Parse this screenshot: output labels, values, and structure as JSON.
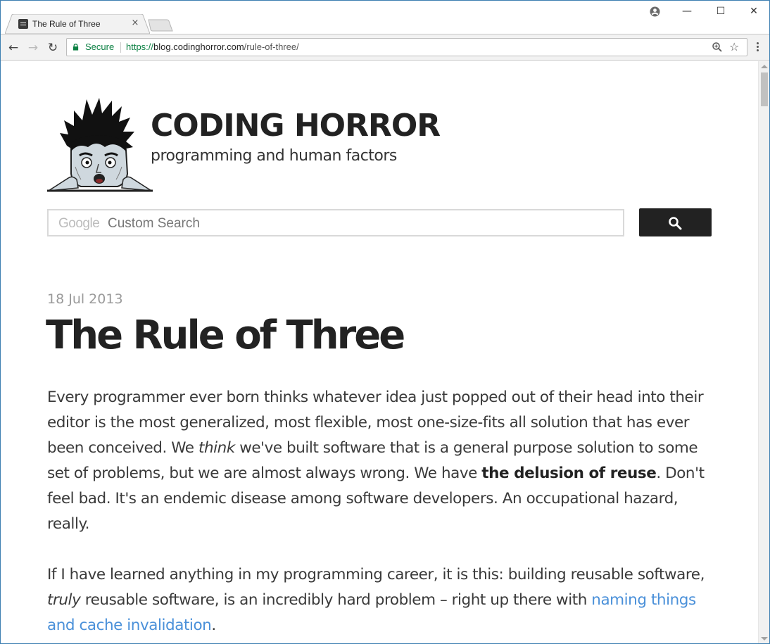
{
  "browser": {
    "tab_title": "The Rule of Three",
    "tab_close": "×",
    "secure_label": "Secure",
    "url_scheme": "https://",
    "url_host": "blog.codinghorror.com",
    "url_path": "/rule-of-three/",
    "back_icon": "←",
    "forward_icon": "→",
    "reload_icon": "↻",
    "zoom_icon": "⊕",
    "bookmark_icon": "☆",
    "minimize_icon": "—",
    "maximize_icon": "☐",
    "close_icon": "✕",
    "secure_color": "#0b8043"
  },
  "site": {
    "title": "CODING HORROR",
    "description": "programming and human factors"
  },
  "search": {
    "google_word": "Google",
    "placeholder": "Custom Search"
  },
  "post": {
    "date": "18 Jul 2013",
    "title": "The Rule of Three",
    "p1_a": "Every programmer ever born thinks whatever idea just popped out of their head into their editor is the most generalized, most flexible, most one-size-fits all solution that has ever been conceived. We ",
    "p1_em": "think",
    "p1_b": " we've built software that is a general purpose solution to some set of problems, but we are almost always wrong. We have ",
    "p1_strong": "the delusion of reuse",
    "p1_c": ". Don't feel bad. It's an endemic disease among software developers. An occupational hazard, really.",
    "p2_a": "If I have learned anything in my programming career, it is this: building reusable software, ",
    "p2_em": "truly",
    "p2_b": " reusable software, is an incredibly hard problem – right up there with ",
    "p2_link": "naming things and cache invalidation",
    "p2_c": ".",
    "link_color": "#4a90d9"
  }
}
